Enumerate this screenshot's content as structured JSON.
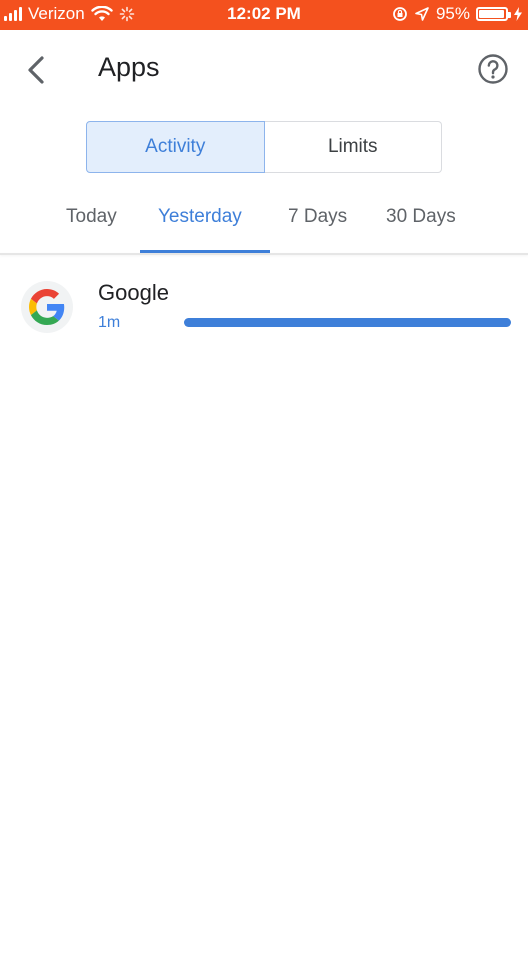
{
  "status_bar": {
    "carrier": "Verizon",
    "time": "12:02 PM",
    "battery": "95%",
    "color": "#f4511e"
  },
  "header": {
    "title": "Apps",
    "back_icon": "chevron-left-icon",
    "help_icon": "help-circle-icon"
  },
  "segmented": {
    "options": [
      {
        "label": "Activity",
        "selected": true
      },
      {
        "label": "Limits",
        "selected": false
      }
    ]
  },
  "tabs": {
    "items": [
      {
        "label": "Today",
        "selected": false
      },
      {
        "label": "Yesterday",
        "selected": true
      },
      {
        "label": "7 Days",
        "selected": false
      },
      {
        "label": "30 Days",
        "selected": false
      }
    ]
  },
  "apps": [
    {
      "name": "Google",
      "time": "1m",
      "usage_fraction": 1.0,
      "icon": "google-g-icon"
    }
  ],
  "colors": {
    "accent": "#3e7fd9",
    "accent_light": "#e3eefc",
    "text_primary": "#202124",
    "text_secondary": "#5f6368"
  }
}
